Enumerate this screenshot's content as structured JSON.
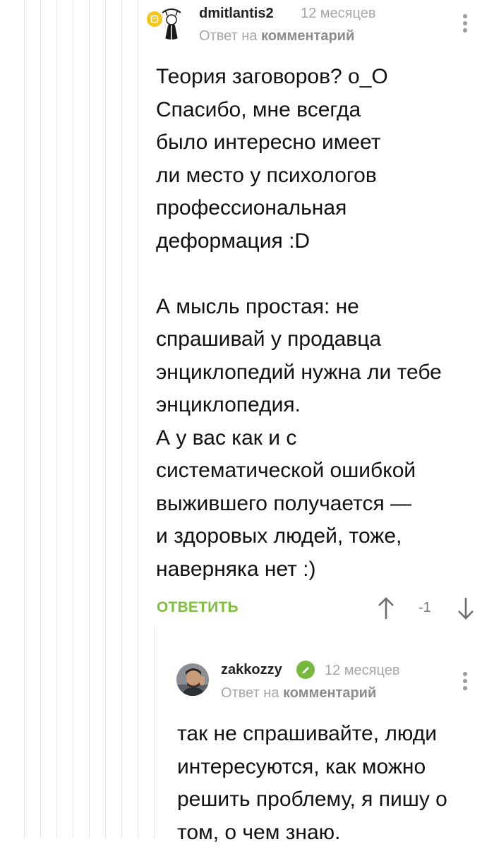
{
  "comments": [
    {
      "author": "dmitlantis2",
      "time": "12 месяцев",
      "reply_prefix": "Ответ на",
      "reply_target": "комментарий",
      "text": "Теория заговоров? о_О\nСпасибо, мне всегда\nбыло интересно имеет\nли место у психологов\nпрофессиональная\nдеформация :D\n\nА мысль простая: не\nспрашивай у продавца\nэнциклопедий нужна ли тебе\nэнциклопедия.\nА у вас как и с\nсистематической ошибкой\nвыжившего получается —\nи здоровых людей, тоже,\nнаверняка нет :)",
      "reply_label": "ОТВЕТИТЬ",
      "rating": "-1",
      "badge_color": "#f5c518"
    },
    {
      "author": "zakkozzy",
      "time": "12 месяцев",
      "reply_prefix": "Ответ на",
      "reply_target": "комментарий",
      "text": "так не спрашивайте, люди\nинтересуются, как можно\nрешить проблему, я пишу о\nтом, о чем знаю.",
      "verified_color": "#79b83f"
    }
  ],
  "colors": {
    "accent_green": "#7cbf3b",
    "muted_text": "#a7a7a7",
    "thread_line": "#e7e7e7"
  }
}
